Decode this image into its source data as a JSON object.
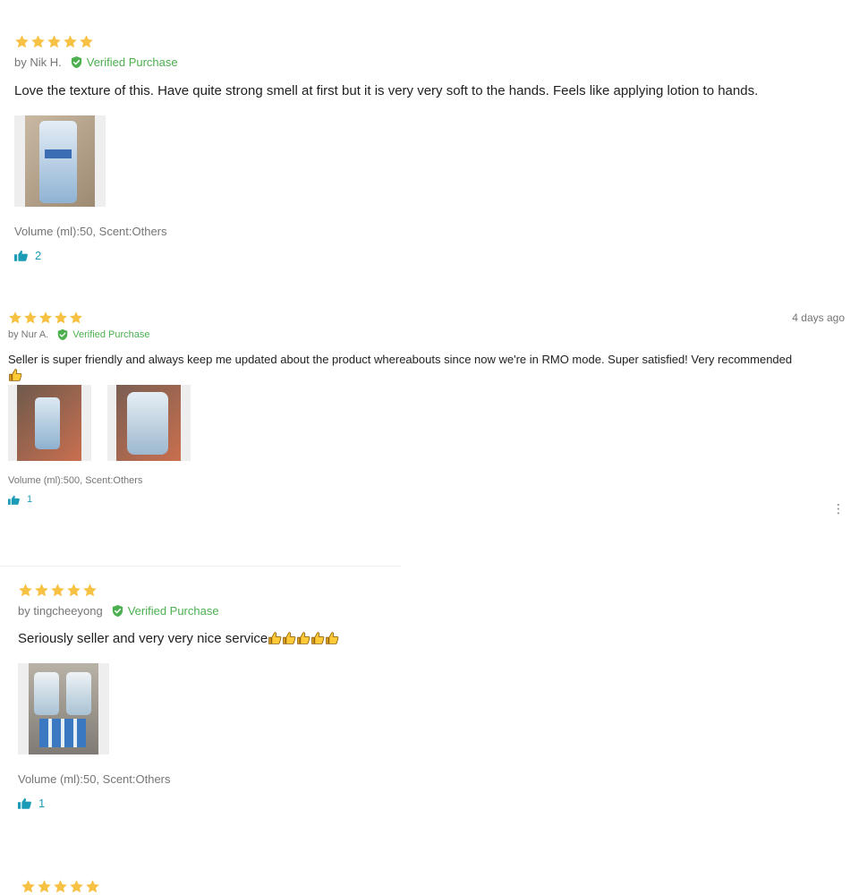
{
  "reviews": [
    {
      "rating": 5,
      "author": "by Nik H.",
      "verified": "Verified Purchase",
      "text": "Love the texture of this. Have quite strong smell at first but it is very very soft to the hands. Feels like applying lotion to hands.",
      "images": [
        "hand-sanitizer-tube-photo"
      ],
      "sku": "Volume (ml):50, Scent:Others",
      "likes": "2"
    },
    {
      "rating": 5,
      "author": "by Nur A.",
      "verified": "Verified Purchase",
      "date": "4 days ago",
      "text": "Seller is super friendly and always keep me updated about the product whereabouts since now we're in RMO mode. Super satisfied! Very recommended",
      "images": [
        "sanitizer-bottle-photo",
        "sanitizer-package-photo"
      ],
      "sku": "Volume (ml):500, Scent:Others",
      "likes": "1",
      "more_icon": "kebab-icon"
    },
    {
      "rating": 5,
      "author": "by tingcheeyong",
      "verified": "Verified Purchase",
      "text": "Seriously seller and very very nice service",
      "images": [
        "sanitizer-bottles-photo"
      ],
      "sku": "Volume (ml):50, Scent:Others",
      "likes": "1"
    },
    {
      "rating": 5
    }
  ],
  "colors": {
    "star": "#f7c244",
    "verified": "#4caf50",
    "like": "#1a9cb7",
    "muted": "#757575"
  }
}
